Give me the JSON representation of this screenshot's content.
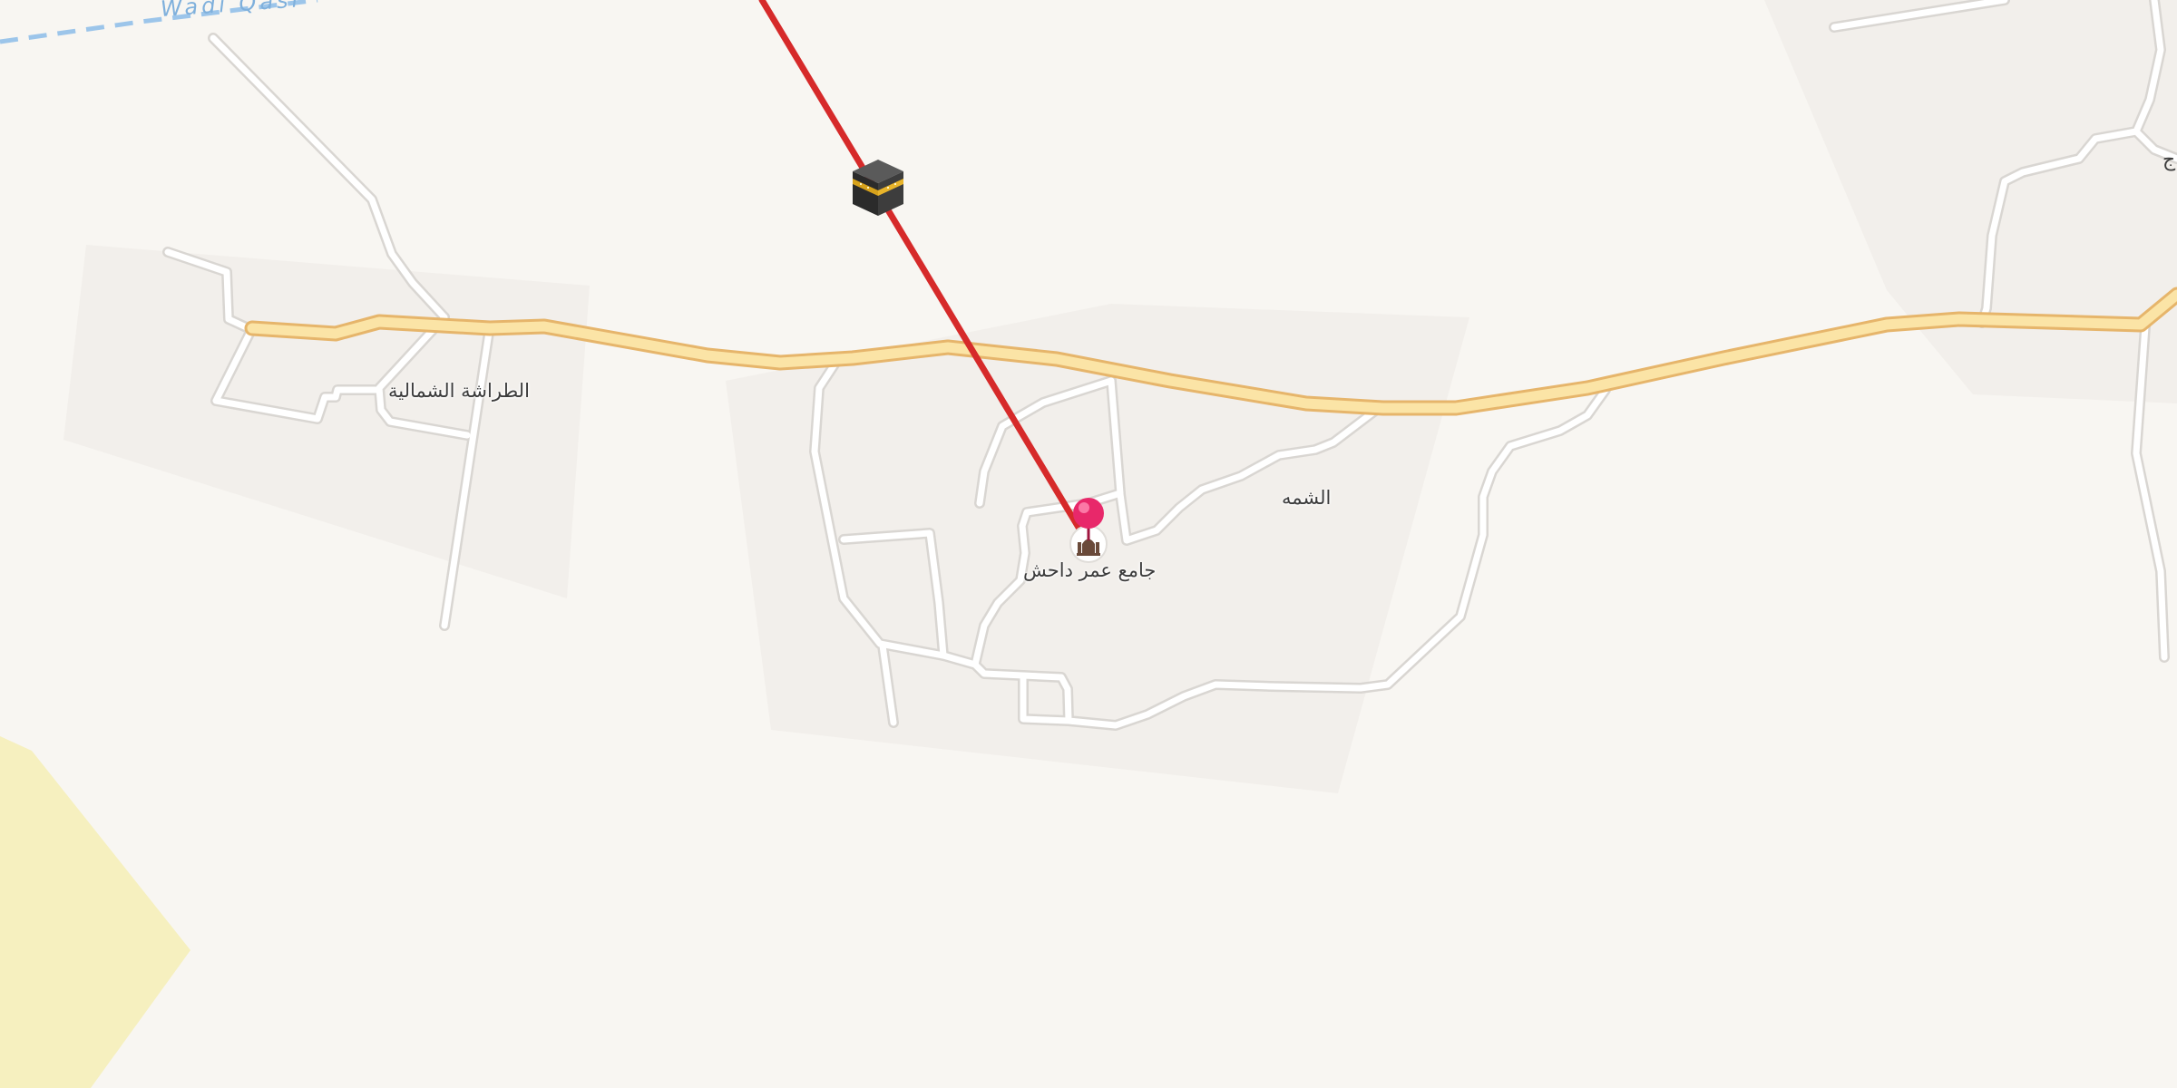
{
  "map": {
    "labels": {
      "wadi": "Wadi Qasi",
      "north_village": "الطراشة الشمالية",
      "alshama": "الشمه",
      "mosque": "جامع عمر داحش",
      "edge_glyph": "ج"
    },
    "icons": {
      "kaaba": "kaaba-icon",
      "pin": "location-pin-icon",
      "mosque": "mosque-icon"
    },
    "colors": {
      "background": "#f8f6f2",
      "residential": "#f1eeea",
      "sand": "#f6f0bf",
      "primary_road": "#fbe4a6",
      "primary_road_casing": "#e9b86f",
      "minor_road": "#ffffff",
      "minor_road_casing": "#dcd9d5",
      "qibla_line": "#d62a2a",
      "waterway": "#9cc5ea",
      "pin": "#e8286a"
    }
  }
}
